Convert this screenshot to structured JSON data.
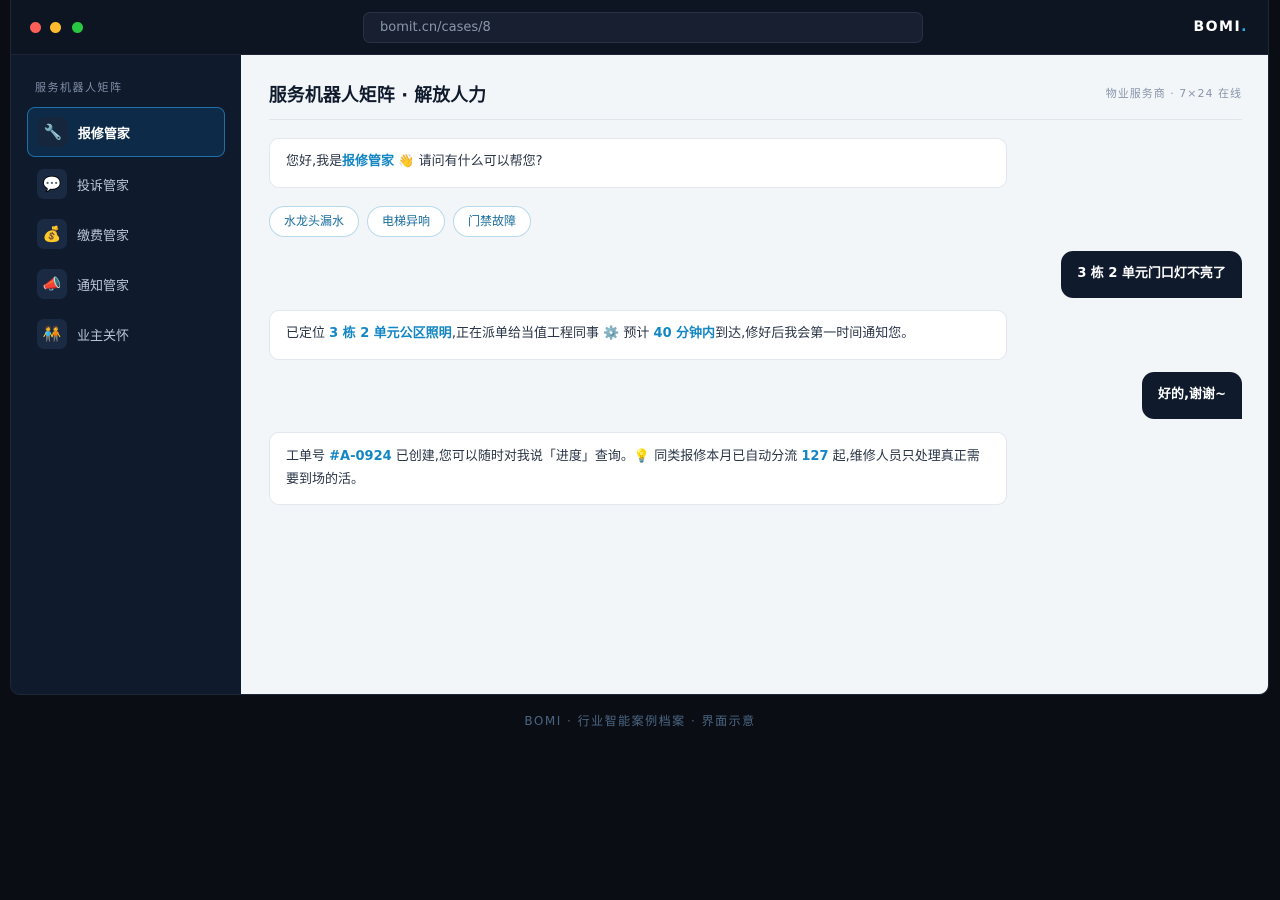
{
  "window": {
    "url": "bomit.cn/cases/8",
    "brand": "BOMI",
    "brand_dot": "."
  },
  "sidebar": {
    "title": "服务机器人矩阵",
    "items": [
      {
        "label": "报修管家",
        "icon": "🔧",
        "icon_name": "wrench-icon",
        "active": true
      },
      {
        "label": "投诉管家",
        "icon": "💬",
        "icon_name": "speech-bubble-icon",
        "active": false
      },
      {
        "label": "缴费管家",
        "icon": "💰",
        "icon_name": "money-bag-icon",
        "active": false
      },
      {
        "label": "通知管家",
        "icon": "📣",
        "icon_name": "megaphone-icon",
        "active": false
      },
      {
        "label": "业主关怀",
        "icon": "🧑‍🤝‍🧑",
        "icon_name": "people-icon",
        "active": false
      }
    ]
  },
  "main": {
    "title": "服务机器人矩阵 · 解放人力",
    "meta": "物业服务商 · 7×24 在线",
    "messages": {
      "m1": {
        "pre": "您好,我是",
        "hl": "报修管家",
        "post": " 👋 请问有什么可以帮您?"
      },
      "chips": [
        "水龙头漏水",
        "电梯异响",
        "门禁故障"
      ],
      "u1": "3 栋 2 单元门口灯不亮了",
      "m2": {
        "pre": "已定位 ",
        "hl1": "3 栋 2 单元公区照明",
        "mid": ",正在派单给当值工程同事 ⚙️ 预计 ",
        "hl2": "40 分钟内",
        "post": "到达,修好后我会第一时间通知您。"
      },
      "u2": "好的,谢谢~",
      "m3": {
        "pre": "工单号 ",
        "hl1": "#A-0924",
        "mid": " 已创建,您可以随时对我说「进度」查询。💡 同类报修本月已自动分流 ",
        "hl2": "127",
        "post": " 起,维修人员只处理真正需要到场的活。"
      }
    }
  },
  "footer": "BOMI · 行业智能案例档案 · 界面示意",
  "colors": {
    "accent": "#1386c4",
    "sidebar_bg": "#0f1a2c",
    "main_bg": "#f3f6f9",
    "user_bubble": "#0f1a2c"
  }
}
